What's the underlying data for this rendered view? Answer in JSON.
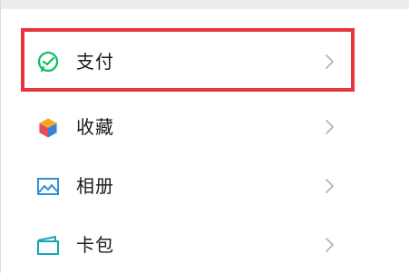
{
  "menu": {
    "items": [
      {
        "label": "支付",
        "icon": "pay-icon"
      },
      {
        "label": "收藏",
        "icon": "favorites-icon"
      },
      {
        "label": "相册",
        "icon": "album-icon"
      },
      {
        "label": "卡包",
        "icon": "card-wallet-icon"
      }
    ]
  },
  "colors": {
    "pay_green": "#07c160",
    "highlight_red": "#e8343a",
    "album_blue": "#2f8fd8",
    "wallet_teal": "#16a6b6"
  }
}
